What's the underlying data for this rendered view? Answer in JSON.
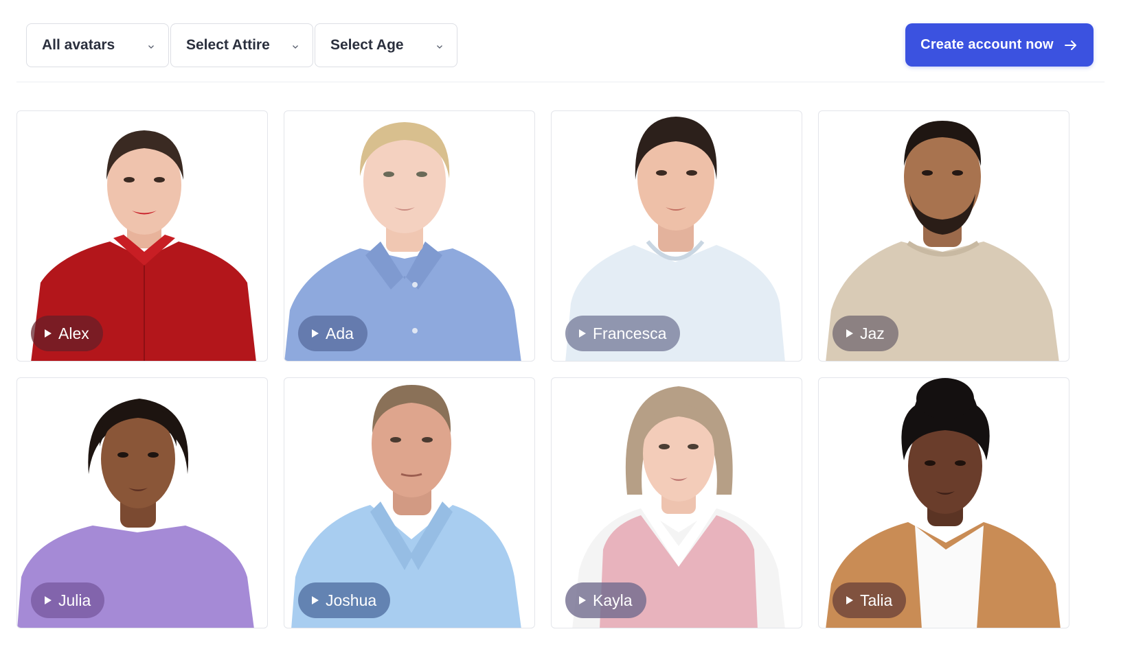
{
  "filters": {
    "avatars": "All avatars",
    "attire": "Select Attire",
    "age": "Select Age"
  },
  "cta": {
    "label": "Create account now",
    "icon": "arrow-right-icon"
  },
  "avatars": [
    {
      "name": "Alex"
    },
    {
      "name": "Ada"
    },
    {
      "name": "Francesca"
    },
    {
      "name": "Jaz"
    },
    {
      "name": "Julia"
    },
    {
      "name": "Joshua"
    },
    {
      "name": "Kayla"
    },
    {
      "name": "Talia"
    }
  ],
  "colors": {
    "accent": "#3b52e0",
    "card_border": "#e3e5ea"
  }
}
